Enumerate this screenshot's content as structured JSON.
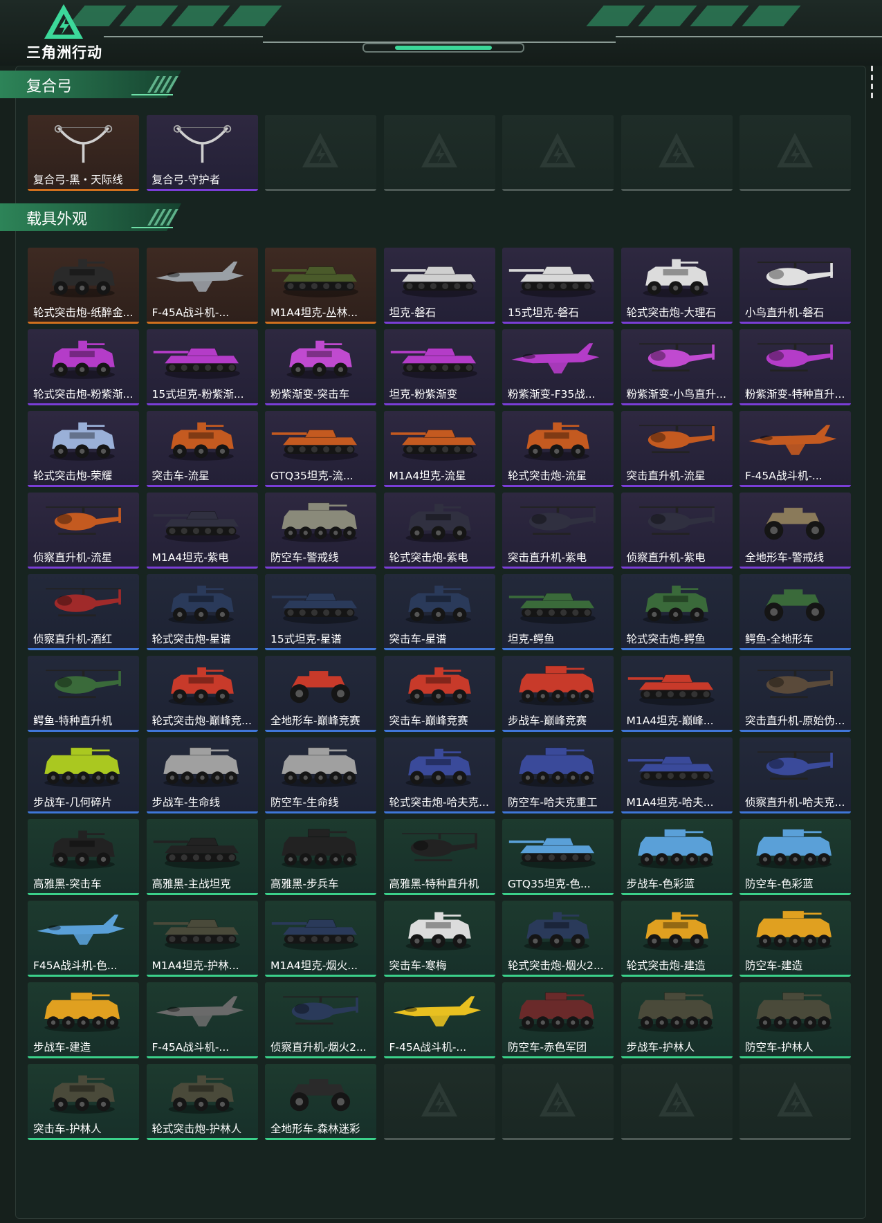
{
  "app": {
    "title": "三角洲行动",
    "logo_icon": "delta-triangle-icon",
    "accent_color": "#3cd89a"
  },
  "rarity_colors": {
    "orange": "#d1701e",
    "purple": "#7a3ed6",
    "blue": "#3f76d8",
    "green": "#3bd08a",
    "empty": "#4e5a56"
  },
  "sections": {
    "bows": {
      "title": "复合弓",
      "items": [
        {
          "name": "复合弓-黑・天际线",
          "rarity": "orange",
          "icon": "compound-bow-icon"
        },
        {
          "name": "复合弓-守护者",
          "rarity": "purple",
          "icon": "compound-bow-icon"
        },
        {
          "name": "",
          "rarity": "empty",
          "icon": "empty-slot-icon"
        },
        {
          "name": "",
          "rarity": "empty",
          "icon": "empty-slot-icon"
        },
        {
          "name": "",
          "rarity": "empty",
          "icon": "empty-slot-icon"
        },
        {
          "name": "",
          "rarity": "empty",
          "icon": "empty-slot-icon"
        },
        {
          "name": "",
          "rarity": "empty",
          "icon": "empty-slot-icon"
        }
      ]
    },
    "vehicles": {
      "title": "载具外观",
      "items": [
        {
          "name": "轮式突击炮-纸醉金...",
          "rarity": "orange",
          "icon": "armored-car-icon",
          "tint": "#2a2a2a"
        },
        {
          "name": "F-45A战斗机-...",
          "rarity": "orange",
          "icon": "jet-icon",
          "tint": "#9aa0a6"
        },
        {
          "name": "M1A4坦克-丛林...",
          "rarity": "orange",
          "icon": "tank-icon",
          "tint": "#4a5a2a"
        },
        {
          "name": "坦克-磐石",
          "rarity": "purple",
          "icon": "tank-icon",
          "tint": "#cfcfcf"
        },
        {
          "name": "15式坦克-磐石",
          "rarity": "purple",
          "icon": "tank-icon",
          "tint": "#d8d8d8"
        },
        {
          "name": "轮式突击炮-大理石",
          "rarity": "purple",
          "icon": "armored-car-icon",
          "tint": "#dcdcdc"
        },
        {
          "name": "小鸟直升机-磐石",
          "rarity": "purple",
          "icon": "helicopter-icon",
          "tint": "#e0e0e0"
        },
        {
          "name": "轮式突击炮-粉紫渐...",
          "rarity": "purple",
          "icon": "armored-car-icon",
          "tint": "#b43cc8"
        },
        {
          "name": "15式坦克-粉紫渐...",
          "rarity": "purple",
          "icon": "tank-icon",
          "tint": "#b43cc8"
        },
        {
          "name": "粉紫渐变-突击车",
          "rarity": "purple",
          "icon": "armored-car-icon",
          "tint": "#c04ad0"
        },
        {
          "name": "坦克-粉紫渐变",
          "rarity": "purple",
          "icon": "tank-icon",
          "tint": "#b43cc8"
        },
        {
          "name": "粉紫渐变-F35战...",
          "rarity": "purple",
          "icon": "jet-icon",
          "tint": "#b43cc8"
        },
        {
          "name": "粉紫渐变-小鸟直升...",
          "rarity": "purple",
          "icon": "helicopter-icon",
          "tint": "#c04ad0"
        },
        {
          "name": "粉紫渐变-特种直升...",
          "rarity": "purple",
          "icon": "helicopter-icon",
          "tint": "#b43cc8"
        },
        {
          "name": "轮式突击炮-荣耀",
          "rarity": "purple",
          "icon": "armored-car-icon",
          "tint": "#9ab0d8"
        },
        {
          "name": "突击车-流星",
          "rarity": "purple",
          "icon": "armored-car-icon",
          "tint": "#c45a20"
        },
        {
          "name": "GTQ35坦克-流...",
          "rarity": "purple",
          "icon": "tank-icon",
          "tint": "#c45a20"
        },
        {
          "name": "M1A4坦克-流星",
          "rarity": "purple",
          "icon": "tank-icon",
          "tint": "#c45a20"
        },
        {
          "name": "轮式突击炮-流星",
          "rarity": "purple",
          "icon": "armored-car-icon",
          "tint": "#c45a20"
        },
        {
          "name": "突击直升机-流星",
          "rarity": "purple",
          "icon": "helicopter-icon",
          "tint": "#c45a20"
        },
        {
          "name": "F-45A战斗机-...",
          "rarity": "purple",
          "icon": "jet-icon",
          "tint": "#c45a20"
        },
        {
          "name": "侦察直升机-流星",
          "rarity": "purple",
          "icon": "helicopter-icon",
          "tint": "#c45a20"
        },
        {
          "name": "M1A4坦克-紫电",
          "rarity": "purple",
          "icon": "tank-icon",
          "tint": "#303040"
        },
        {
          "name": "防空车-警戒线",
          "rarity": "purple",
          "icon": "apc-icon",
          "tint": "#8a8a7a"
        },
        {
          "name": "轮式突击炮-紫电",
          "rarity": "purple",
          "icon": "armored-car-icon",
          "tint": "#303040"
        },
        {
          "name": "突击直升机-紫电",
          "rarity": "purple",
          "icon": "helicopter-icon",
          "tint": "#303040"
        },
        {
          "name": "侦察直升机-紫电",
          "rarity": "purple",
          "icon": "helicopter-icon",
          "tint": "#303040"
        },
        {
          "name": "全地形车-警戒线",
          "rarity": "purple",
          "icon": "atv-icon",
          "tint": "#8a7a5a"
        },
        {
          "name": "侦察直升机-酒红",
          "rarity": "blue",
          "icon": "helicopter-icon",
          "tint": "#a02a2a"
        },
        {
          "name": "轮式突击炮-星谱",
          "rarity": "blue",
          "icon": "armored-car-icon",
          "tint": "#2a3a5a"
        },
        {
          "name": "15式坦克-星谱",
          "rarity": "blue",
          "icon": "tank-icon",
          "tint": "#2a3a5a"
        },
        {
          "name": "突击车-星谱",
          "rarity": "blue",
          "icon": "armored-car-icon",
          "tint": "#2a3a5a"
        },
        {
          "name": "坦克-鳄鱼",
          "rarity": "blue",
          "icon": "tank-icon",
          "tint": "#3a6a3a"
        },
        {
          "name": "轮式突击炮-鳄鱼",
          "rarity": "blue",
          "icon": "armored-car-icon",
          "tint": "#3a6a3a"
        },
        {
          "name": "鳄鱼-全地形车",
          "rarity": "blue",
          "icon": "atv-icon",
          "tint": "#3a6a3a"
        },
        {
          "name": "鳄鱼-特种直升机",
          "rarity": "blue",
          "icon": "helicopter-icon",
          "tint": "#3a6a3a"
        },
        {
          "name": "轮式突击炮-巅峰竞...",
          "rarity": "blue",
          "icon": "armored-car-icon",
          "tint": "#c83a2a"
        },
        {
          "name": "全地形车-巅峰竞赛",
          "rarity": "blue",
          "icon": "atv-icon",
          "tint": "#c83a2a"
        },
        {
          "name": "突击车-巅峰竞赛",
          "rarity": "blue",
          "icon": "armored-car-icon",
          "tint": "#c83a2a"
        },
        {
          "name": "步战车-巅峰竞赛",
          "rarity": "blue",
          "icon": "apc-icon",
          "tint": "#c83a2a"
        },
        {
          "name": "M1A4坦克-巅峰...",
          "rarity": "blue",
          "icon": "tank-icon",
          "tint": "#c83a2a"
        },
        {
          "name": "突击直升机-原始伪...",
          "rarity": "blue",
          "icon": "helicopter-icon",
          "tint": "#5a4a3a"
        },
        {
          "name": "步战车-几何碎片",
          "rarity": "blue",
          "icon": "apc-icon",
          "tint": "#aac820"
        },
        {
          "name": "步战车-生命线",
          "rarity": "blue",
          "icon": "apc-icon",
          "tint": "#a0a0a0"
        },
        {
          "name": "防空车-生命线",
          "rarity": "blue",
          "icon": "apc-icon",
          "tint": "#a0a0a0"
        },
        {
          "name": "轮式突击炮-哈夫克...",
          "rarity": "blue",
          "icon": "armored-car-icon",
          "tint": "#3a4a9a"
        },
        {
          "name": "防空车-哈夫克重工",
          "rarity": "blue",
          "icon": "apc-icon",
          "tint": "#3a4a9a"
        },
        {
          "name": "M1A4坦克-哈夫...",
          "rarity": "blue",
          "icon": "tank-icon",
          "tint": "#3a4a9a"
        },
        {
          "name": "侦察直升机-哈夫克...",
          "rarity": "blue",
          "icon": "helicopter-icon",
          "tint": "#3a4a9a"
        },
        {
          "name": "高雅黑-突击车",
          "rarity": "green",
          "icon": "armored-car-icon",
          "tint": "#222222"
        },
        {
          "name": "高雅黑-主战坦克",
          "rarity": "green",
          "icon": "tank-icon",
          "tint": "#222222"
        },
        {
          "name": "高雅黑-步兵车",
          "rarity": "green",
          "icon": "apc-icon",
          "tint": "#222222"
        },
        {
          "name": "高雅黑-特种直升机",
          "rarity": "green",
          "icon": "helicopter-icon",
          "tint": "#222222"
        },
        {
          "name": "GTQ35坦克-色...",
          "rarity": "green",
          "icon": "tank-icon",
          "tint": "#5aa0d8"
        },
        {
          "name": "步战车-色彩蓝",
          "rarity": "green",
          "icon": "apc-icon",
          "tint": "#5aa0d8"
        },
        {
          "name": "防空车-色彩蓝",
          "rarity": "green",
          "icon": "apc-icon",
          "tint": "#5aa0d8"
        },
        {
          "name": "F45A战斗机-色...",
          "rarity": "green",
          "icon": "jet-icon",
          "tint": "#5aa0d8"
        },
        {
          "name": "M1A4坦克-护林...",
          "rarity": "green",
          "icon": "tank-icon",
          "tint": "#4a4a3a"
        },
        {
          "name": "M1A4坦克-烟火...",
          "rarity": "green",
          "icon": "tank-icon",
          "tint": "#2a3a5a"
        },
        {
          "name": "突击车-寒梅",
          "rarity": "green",
          "icon": "armored-car-icon",
          "tint": "#dcdcdc"
        },
        {
          "name": "轮式突击炮-烟火2...",
          "rarity": "green",
          "icon": "armored-car-icon",
          "tint": "#2a3a5a"
        },
        {
          "name": "轮式突击炮-建造",
          "rarity": "green",
          "icon": "armored-car-icon",
          "tint": "#e0a020"
        },
        {
          "name": "防空车-建造",
          "rarity": "green",
          "icon": "apc-icon",
          "tint": "#e0a020"
        },
        {
          "name": "步战车-建造",
          "rarity": "green",
          "icon": "apc-icon",
          "tint": "#e0a020"
        },
        {
          "name": "F-45A战斗机-...",
          "rarity": "green",
          "icon": "jet-icon",
          "tint": "#6a6a6a"
        },
        {
          "name": "侦察直升机-烟火2...",
          "rarity": "green",
          "icon": "helicopter-icon",
          "tint": "#2a3a5a"
        },
        {
          "name": "F-45A战斗机-...",
          "rarity": "green",
          "icon": "jet-icon",
          "tint": "#e8c020"
        },
        {
          "name": "防空车-赤色军团",
          "rarity": "green",
          "icon": "apc-icon",
          "tint": "#6a2a2a"
        },
        {
          "name": "步战车-护林人",
          "rarity": "green",
          "icon": "apc-icon",
          "tint": "#4a4a3a"
        },
        {
          "name": "防空车-护林人",
          "rarity": "green",
          "icon": "apc-icon",
          "tint": "#4a4a3a"
        },
        {
          "name": "突击车-护林人",
          "rarity": "green",
          "icon": "armored-car-icon",
          "tint": "#4a4a3a"
        },
        {
          "name": "轮式突击炮-护林人",
          "rarity": "green",
          "icon": "armored-car-icon",
          "tint": "#4a4a3a"
        },
        {
          "name": "全地形车-森林迷彩",
          "rarity": "green",
          "icon": "atv-icon",
          "tint": "#2a2a2a"
        },
        {
          "name": "",
          "rarity": "empty",
          "icon": "empty-slot-icon"
        },
        {
          "name": "",
          "rarity": "empty",
          "icon": "empty-slot-icon"
        },
        {
          "name": "",
          "rarity": "empty",
          "icon": "empty-slot-icon"
        },
        {
          "name": "",
          "rarity": "empty",
          "icon": "empty-slot-icon"
        }
      ]
    }
  }
}
